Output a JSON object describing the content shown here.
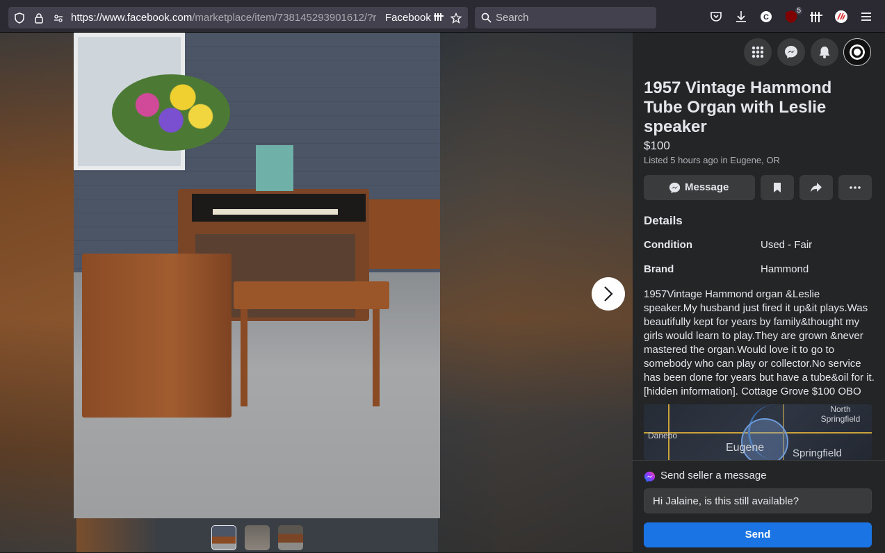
{
  "browser": {
    "url_main": "https://www.facebook.com",
    "url_path": "/marketplace/item/738145293901612/?r",
    "site_label": "Facebook",
    "search_placeholder": "Search",
    "extension_badge": "5"
  },
  "listing": {
    "title": "1957 Vintage Hammond Tube Organ with Leslie speaker",
    "price": "$100",
    "listed": "Listed 5 hours ago in Eugene, OR",
    "message_label": "Message",
    "details_heading": "Details",
    "details": [
      {
        "key": "Condition",
        "value": "Used - Fair"
      },
      {
        "key": "Brand",
        "value": "Hammond"
      }
    ],
    "description": "1957Vintage Hammond organ &Leslie speaker.My husband just fired it up&it plays.Was beautifully kept for years by family&thought my girls would learn to play.They are grown &never mastered the organ.Would love it to go to somebody who can play or collector.No service has been done for years but have a tube&oil for it. [hidden information]. Cottage Grove $100 OBO",
    "map_labels": {
      "danebo": "Danebo",
      "eugene": "Eugene",
      "springfield": "Springfield",
      "north_springfield": "North Springfield"
    }
  },
  "compose": {
    "header": "Send seller a message",
    "input_value": "Hi Jalaine, is this still available?",
    "send_label": "Send"
  },
  "colors": {
    "accent": "#1b74e4",
    "panel_bg": "#242526",
    "button_bg": "#3a3b3c"
  }
}
